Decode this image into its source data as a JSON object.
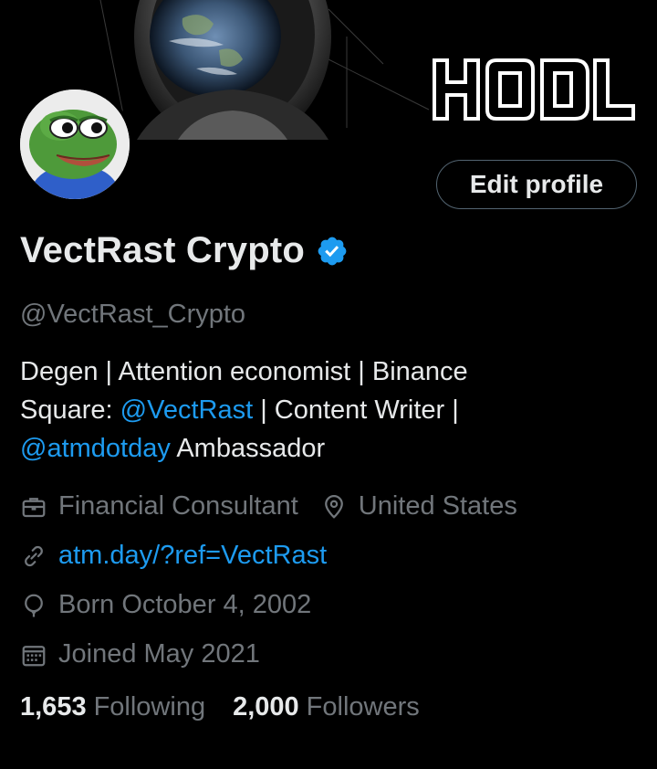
{
  "banner": {
    "hodl_text": "HODL",
    "colors": {
      "background": "#000000",
      "hodl_stroke": "#ffffff"
    }
  },
  "profile": {
    "edit_button_label": "Edit profile",
    "display_name": "VectRast Crypto",
    "verified_icon": "verified-badge-icon",
    "handle": "@VectRast_Crypto",
    "bio": {
      "line1": "Degen | Attention economist | Binance",
      "line2_prefix": "Square: ",
      "line2_mention": "@VectRast",
      "line2_suffix": " | Content Writer |",
      "line3_mention": "@atmdotday",
      "line3_suffix": " Ambassador"
    },
    "category": "Financial Consultant",
    "location": "United States",
    "website": "atm.day/?ref=VectRast",
    "birthday": "Born October 4, 2002",
    "joined": "Joined May 2021",
    "following_count": "1,653",
    "following_label": "Following",
    "followers_count": "2,000",
    "followers_label": "Followers"
  },
  "colors": {
    "background": "#000000",
    "primary_text": "#e7e9ea",
    "secondary_text": "#71767b",
    "link": "#1d9bf0",
    "verified": "#1d9bf0",
    "button_border": "#536471"
  },
  "icons": [
    "briefcase-icon",
    "location-pin-icon",
    "link-icon",
    "balloon-icon",
    "calendar-icon",
    "verified-badge-icon"
  ]
}
